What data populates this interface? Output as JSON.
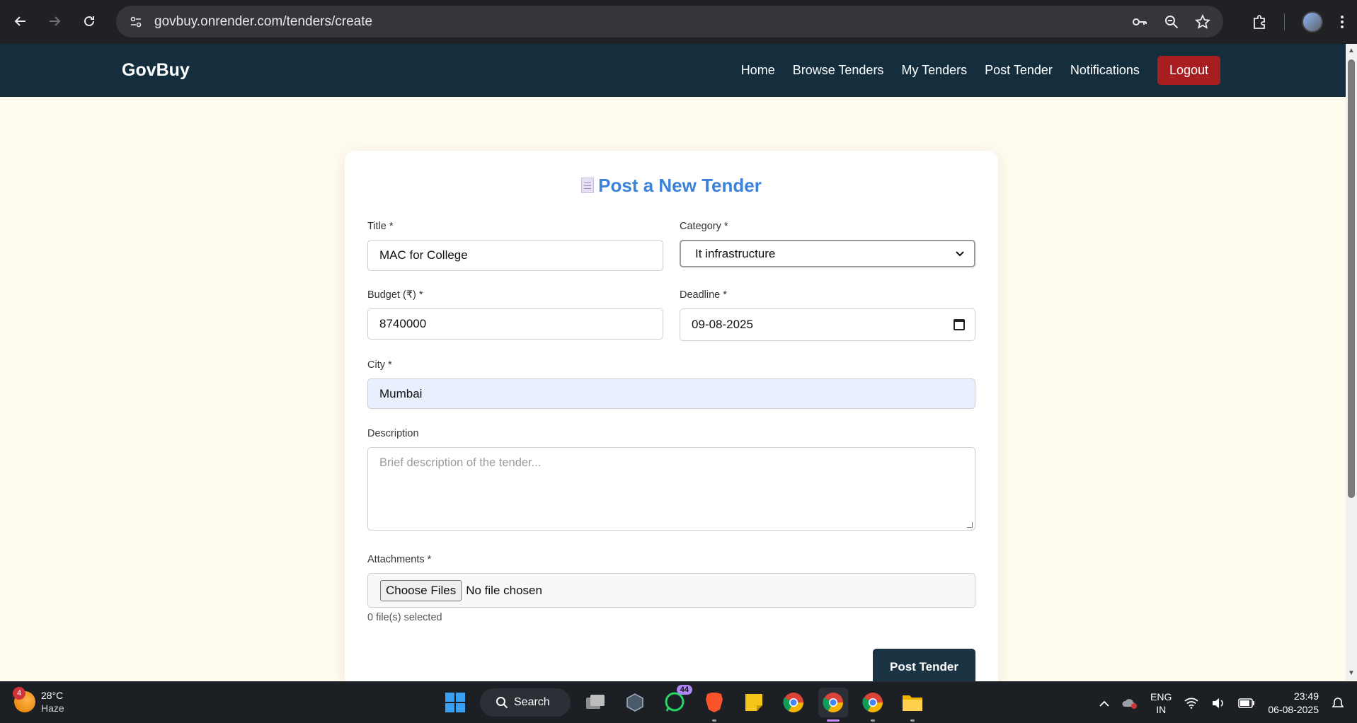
{
  "browser": {
    "url": "govbuy.onrender.com/tenders/create"
  },
  "site": {
    "brand": "GovBuy",
    "nav": [
      "Home",
      "Browse Tenders",
      "My Tenders",
      "Post Tender",
      "Notifications"
    ],
    "logout": "Logout"
  },
  "form": {
    "heading": "Post a New Tender",
    "title_label": "Title *",
    "title_value": "MAC for College",
    "category_label": "Category *",
    "category_value": "It infrastructure",
    "budget_label": "Budget (₹) *",
    "budget_value": "8740000",
    "deadline_label": "Deadline *",
    "deadline_value": "09-08-2025",
    "city_label": "City *",
    "city_value": "Mumbai",
    "description_label": "Description",
    "description_placeholder": "Brief description of the tender...",
    "attachments_label": "Attachments *",
    "choose_files": "Choose Files",
    "no_file": "No file chosen",
    "file_count": "0 file(s) selected",
    "submit": "Post Tender"
  },
  "taskbar": {
    "weather_badge": "4",
    "temperature": "28°C",
    "condition": "Haze",
    "search": "Search",
    "whatsapp_badge": "44",
    "lang_top": "ENG",
    "lang_bottom": "IN",
    "time": "23:49",
    "date": "06-08-2025"
  }
}
